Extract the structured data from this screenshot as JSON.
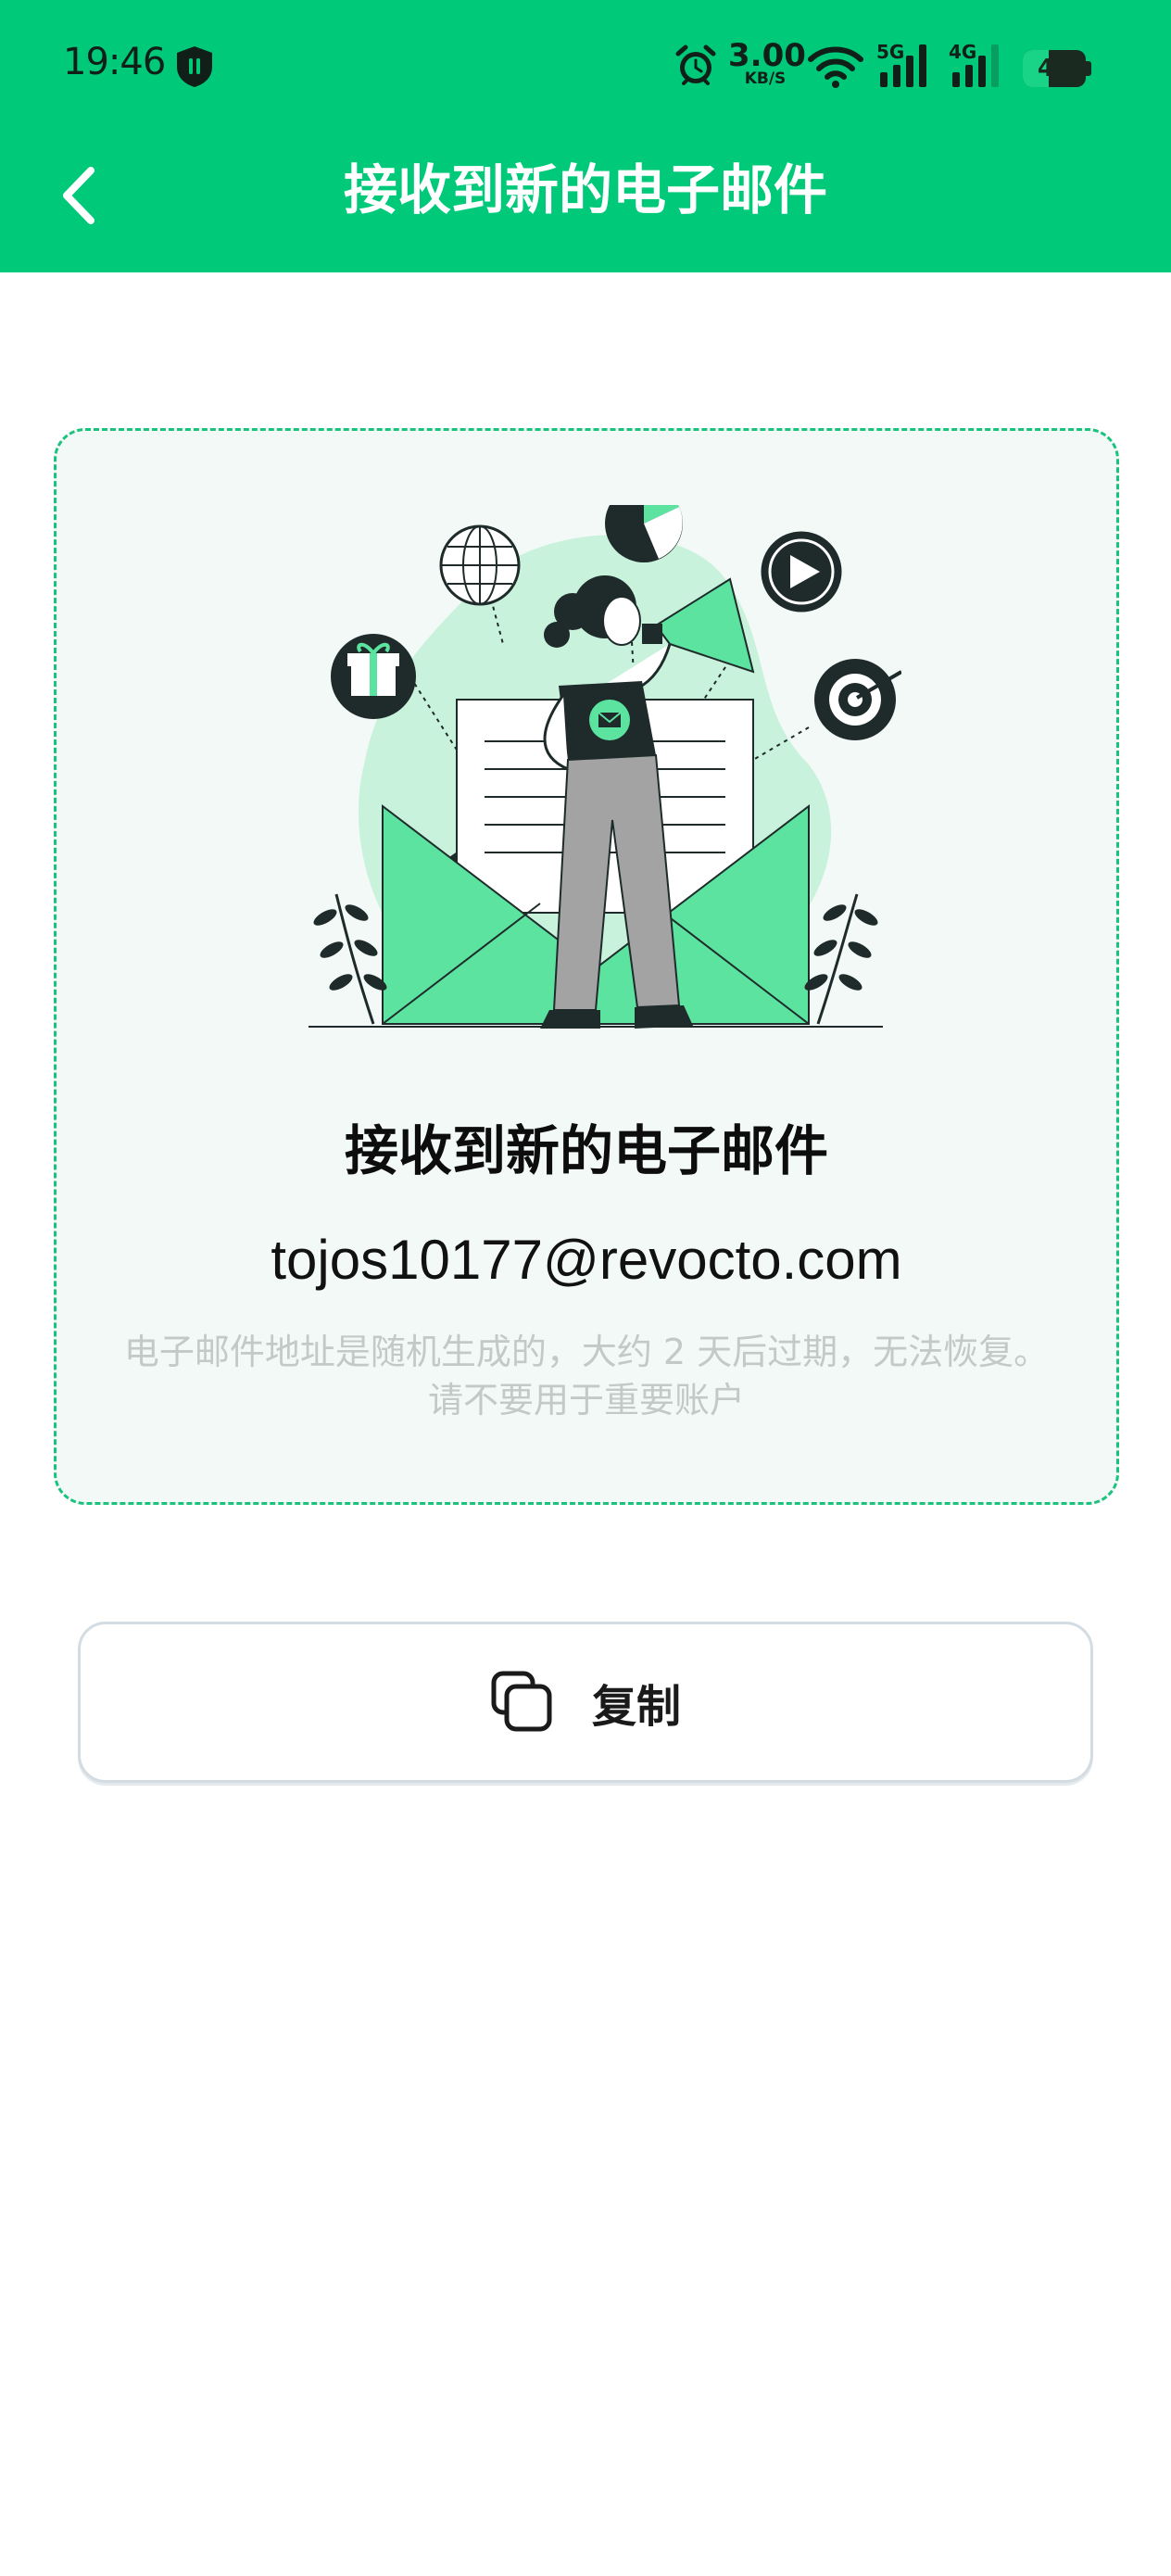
{
  "status_bar": {
    "time": "19:46",
    "net_speed_value": "3.00",
    "net_speed_unit": "KB/S",
    "sim1_label": "5G",
    "sim2_label": "4G",
    "battery_percent": "41",
    "battery_level": 0.41
  },
  "app_bar": {
    "title": "接收到新的电子邮件"
  },
  "card": {
    "title": "接收到新的电子邮件",
    "email": "tojos10177@revocto.com",
    "note": "电子邮件地址是随机生成的，大约 2 天后过期，无法恢复。请不要用于重要账户"
  },
  "actions": {
    "copy_label": "复制"
  },
  "colors": {
    "primary": "#00c97a",
    "card_border": "#19c37d",
    "card_bg": "#f2f9f6",
    "note_text": "#c4c9c7"
  },
  "icons": [
    "shield-icon",
    "alarm-icon",
    "wifi-icon",
    "signal-icon",
    "battery-icon",
    "back-arrow-icon",
    "copy-icon"
  ]
}
